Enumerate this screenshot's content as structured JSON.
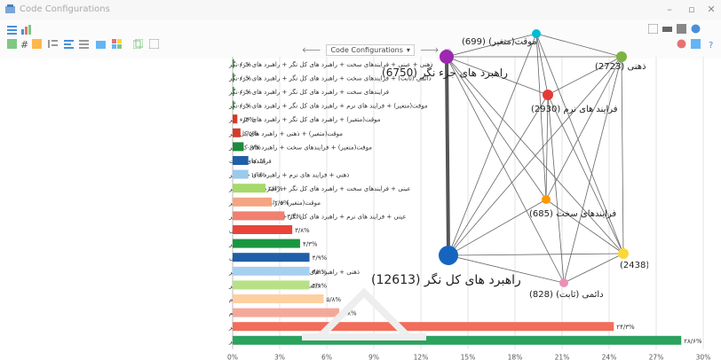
{
  "window": {
    "title": "Code Configurations"
  },
  "toolbar": {
    "nav_label": "Code Configurations",
    "left_icons": [
      "list-icon",
      "chart-icon",
      "grid-icon",
      "hash-icon",
      "table-icon",
      "indent-icon",
      "align-icon",
      "sort-icon",
      "chart-bar-icon",
      "palette-icon",
      "copy-icon"
    ],
    "right_icons": [
      "export-icon",
      "print-icon",
      "save-icon",
      "settings-icon",
      "legend-icon",
      "layout-icon",
      "help-icon"
    ]
  },
  "chart_data": [
    {
      "type": "bar",
      "orientation": "horizontal",
      "categories": [
        "ذهنی + عینی + فرایندهای سخت + راهبرد های کل نگر + راهبرد های جزء نگر",
        "دائمی (ثابت) + فرایندهای سخت + راهبرد های کل نگر + راهبرد های جزء نگر",
        "فرایندهای سخت + راهبرد های کل نگر + راهبرد های جزء نگر",
        "موقت(متغیر) + فرایند های نرم + راهبرد های کل نگر + راهبرد های جزء نگر",
        "موقت(متغیر) + راهبرد های کل نگر + راهبرد های جزء نگر",
        "موقت(متغیر) + ذهنی + راهبرد های کل نگر",
        "موقت(متغیر) + فرایندهای سخت + راهبرد های کل نگر",
        "فرایندهای سخت",
        "ذهنی + فرایند های نرم + راهبرد های جزء نگر",
        "عینی + فرایندهای سخت + راهبرد های کل نگر + راهبرد های جزء نگر",
        "موقت(متغیر) + راهبرد های کل نگر",
        "عینی + فرایند های نرم + راهبرد های کل نگر + راهبرد های جزء نگر",
        "ذهنی",
        "عینی + راهبرد های کل نگر",
        "عینی",
        "ذهنی + راهبرد های کل نگر + راهبرد های جزء نگر",
        "دائمی (ثابت) + راهبرد های کل نگر",
        "ذهنی + فرایند های نرم",
        "فرایند های نرم",
        "راهبرد های کل نگر + راهبرد های جزء نگر",
        "راهبرد های کل نگر"
      ],
      "values": [
        0.0,
        0.0,
        0.0,
        0.0,
        0.3,
        0.5,
        0.7,
        1.0,
        1.0,
        2.1,
        2.5,
        3.3,
        3.8,
        4.3,
        4.9,
        4.9,
        4.9,
        5.8,
        6.8,
        24.3,
        28.6
      ],
      "value_labels": [
        "٠/٠%",
        "٠/٠%",
        "٠/٠%",
        "٠/٠%",
        "٠/٣%",
        "٠/۵%",
        "٠/٧%",
        "١/٠%",
        "١/٠%",
        "٢/١%",
        "٢/۵%",
        "٣/٣%",
        "٣/٨%",
        "۴/٣%",
        "۴/٩%",
        "۴/٩%",
        "۴/٩%",
        "۵/٨%",
        "۶/٨%",
        "٢۴/٣%",
        "٢٨/۶%"
      ],
      "bar_colors": [
        "#2e8b2e",
        "#2e8b2e",
        "#2e8b2e",
        "#2e8b2e",
        "#d33b2a",
        "#d33b2a",
        "#1e8a3c",
        "#1f5fa8",
        "#9cc9ec",
        "#a6d96a",
        "#f4a582",
        "#f08070",
        "#e8443a",
        "#1a9641",
        "#1f5fa8",
        "#a6d0f0",
        "#b8e186",
        "#fdd0a2",
        "#f4a899",
        "#f26d5b",
        "#2ca25f"
      ],
      "xticks": [
        "0%",
        "3%",
        "6%",
        "9%",
        "12%",
        "15%",
        "18%",
        "21%",
        "24%",
        "27%",
        "30%"
      ],
      "xlim": [
        0,
        30
      ],
      "grid": "vertical"
    },
    {
      "type": "network",
      "nodes": [
        {
          "id": "temp",
          "label": "موقت(متغیر) (699)",
          "color": "#00bcd4"
        },
        {
          "id": "mental",
          "label": "ذهنی (2723)",
          "color": "#7cb342"
        },
        {
          "id": "detail",
          "label": "راهبرد های جزء نگر (6750)",
          "color": "#9c27b0"
        },
        {
          "id": "soft",
          "label": "فرایند های نرم (2930)",
          "color": "#e53935"
        },
        {
          "id": "hard",
          "label": "فرایندهای سخت (685)",
          "color": "#ff9800"
        },
        {
          "id": "holistic",
          "label": "راهبرد های کل نگر (12613)",
          "color": "#1565c0"
        },
        {
          "id": "objective",
          "label": "عینی (2438)",
          "color": "#fdd835"
        },
        {
          "id": "perm",
          "label": "دائمی (ثابت) (828)",
          "color": "#e991b5"
        }
      ]
    }
  ]
}
